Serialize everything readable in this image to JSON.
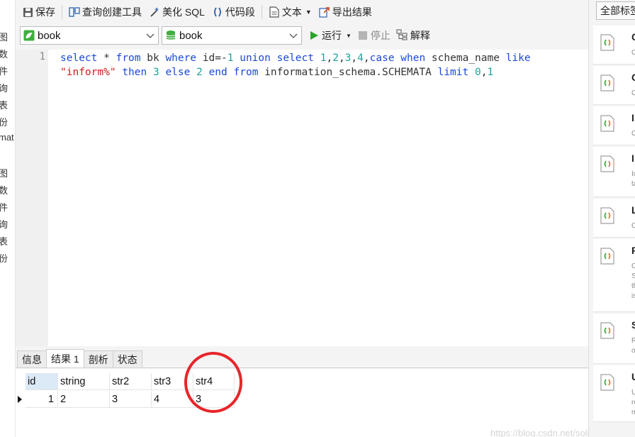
{
  "left_strip": [
    "图",
    "数",
    "件",
    "询",
    "表",
    "份",
    "mat",
    "图",
    "数",
    "件",
    "询",
    "表",
    "份"
  ],
  "toolbar": {
    "save": "保存",
    "query_builder": "查询创建工具",
    "beautify_sql": "美化 SQL",
    "snippet": "代码段",
    "text": "文本",
    "export": "导出结果"
  },
  "selectors": {
    "connection": "book",
    "database": "book"
  },
  "actions": {
    "run": "运行",
    "stop": "停止",
    "explain": "解释"
  },
  "editor": {
    "line_number": "1",
    "line1": [
      {
        "t": "select",
        "c": "kw"
      },
      {
        "t": " * ",
        "c": "plain"
      },
      {
        "t": "from",
        "c": "kw"
      },
      {
        "t": " bk ",
        "c": "plain"
      },
      {
        "t": "where",
        "c": "kw"
      },
      {
        "t": " id=-",
        "c": "plain"
      },
      {
        "t": "1",
        "c": "num"
      },
      {
        "t": " ",
        "c": "plain"
      },
      {
        "t": "union",
        "c": "kw"
      },
      {
        "t": " ",
        "c": "plain"
      },
      {
        "t": "select",
        "c": "kw"
      },
      {
        "t": " ",
        "c": "plain"
      },
      {
        "t": "1",
        "c": "num"
      },
      {
        "t": ",",
        "c": "plain"
      },
      {
        "t": "2",
        "c": "num"
      },
      {
        "t": ",",
        "c": "plain"
      },
      {
        "t": "3",
        "c": "num"
      },
      {
        "t": ",",
        "c": "plain"
      },
      {
        "t": "4",
        "c": "num"
      },
      {
        "t": ",",
        "c": "plain"
      },
      {
        "t": "case",
        "c": "kw"
      },
      {
        "t": " ",
        "c": "plain"
      },
      {
        "t": "when",
        "c": "kw"
      },
      {
        "t": " schema_name ",
        "c": "plain"
      },
      {
        "t": "like",
        "c": "kw"
      }
    ],
    "line2": [
      {
        "t": "\"inform%\"",
        "c": "str"
      },
      {
        "t": " ",
        "c": "plain"
      },
      {
        "t": "then",
        "c": "kw"
      },
      {
        "t": " ",
        "c": "plain"
      },
      {
        "t": "3",
        "c": "num"
      },
      {
        "t": " ",
        "c": "plain"
      },
      {
        "t": "else",
        "c": "kw"
      },
      {
        "t": " ",
        "c": "plain"
      },
      {
        "t": "2",
        "c": "num"
      },
      {
        "t": " ",
        "c": "plain"
      },
      {
        "t": "end",
        "c": "kw"
      },
      {
        "t": " ",
        "c": "plain"
      },
      {
        "t": "from",
        "c": "kw"
      },
      {
        "t": " information_schema.SCHEMATA ",
        "c": "plain"
      },
      {
        "t": "limit",
        "c": "kw"
      },
      {
        "t": " ",
        "c": "plain"
      },
      {
        "t": "0",
        "c": "num"
      },
      {
        "t": ",",
        "c": "plain"
      },
      {
        "t": "1",
        "c": "num"
      }
    ]
  },
  "result_tabs": [
    "信息",
    "结果 1",
    "剖析",
    "状态"
  ],
  "result_grid": {
    "columns": [
      "id",
      "string",
      "str2",
      "str3",
      "str4"
    ],
    "row": [
      "1",
      "2",
      "3",
      "4",
      "3"
    ]
  },
  "watermark": "https://blog.csdn.net/solitudi",
  "right_panel": {
    "header": "全部标签",
    "snippets": [
      {
        "title": "C",
        "desc": [
          "C"
        ]
      },
      {
        "title": "C",
        "desc": [
          "C"
        ]
      },
      {
        "title": "I",
        "desc": [
          "C"
        ]
      },
      {
        "title": "I",
        "desc": [
          "In",
          "ta"
        ]
      },
      {
        "title": "L",
        "desc": [
          "C"
        ]
      },
      {
        "title": "F",
        "desc": [
          "C",
          "S",
          "th",
          "is"
        ]
      },
      {
        "title": "S",
        "desc": [
          "R",
          "o"
        ]
      },
      {
        "title": "U",
        "desc": [
          "U",
          "re",
          "m"
        ]
      }
    ]
  },
  "colors": {
    "keyword": "#1a49d6",
    "number": "#1ca39a",
    "string": "#cc1f1f",
    "annotation": "#e8252a",
    "run_icon": "#2aa52a"
  }
}
